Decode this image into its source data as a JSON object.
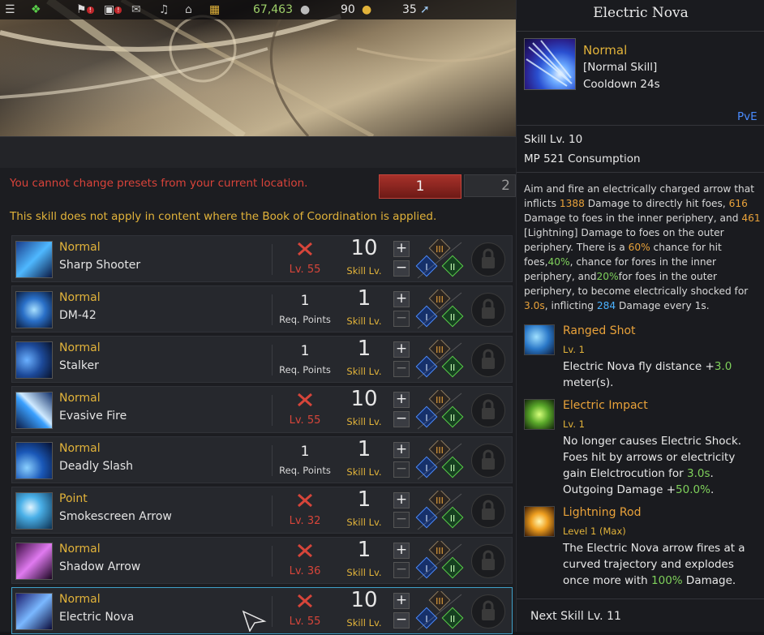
{
  "topbar": {
    "currency1": "67,463",
    "currency2": "90",
    "currency3": "35"
  },
  "warnings": {
    "preset": "You cannot change presets from your current location.",
    "book": "This skill does not apply in content where the Book of Coordination is applied."
  },
  "presets": [
    "1",
    "2"
  ],
  "skills": [
    {
      "type": "Normal",
      "name": "Sharp Shooter",
      "req_kind": "locked",
      "req": "Lv. 55",
      "skill_level": "10",
      "skill_lv_label": "Skill Lv."
    },
    {
      "type": "Normal",
      "name": "DM-42",
      "req_kind": "points",
      "req": "1",
      "req_label": "Req. Points",
      "skill_level": "1",
      "skill_lv_label": "Skill Lv."
    },
    {
      "type": "Normal",
      "name": "Stalker",
      "req_kind": "points",
      "req": "1",
      "req_label": "Req. Points",
      "skill_level": "1",
      "skill_lv_label": "Skill Lv."
    },
    {
      "type": "Normal",
      "name": "Evasive Fire",
      "req_kind": "locked",
      "req": "Lv. 55",
      "skill_level": "10",
      "skill_lv_label": "Skill Lv."
    },
    {
      "type": "Normal",
      "name": "Deadly Slash",
      "req_kind": "points",
      "req": "1",
      "req_label": "Req. Points",
      "skill_level": "1",
      "skill_lv_label": "Skill Lv."
    },
    {
      "type": "Point",
      "name": "Smokescreen Arrow",
      "req_kind": "locked",
      "req": "Lv. 32",
      "skill_level": "1",
      "skill_lv_label": "Skill Lv."
    },
    {
      "type": "Normal",
      "name": "Shadow Arrow",
      "req_kind": "locked",
      "req": "Lv. 36",
      "skill_level": "1",
      "skill_lv_label": "Skill Lv."
    },
    {
      "type": "Normal",
      "name": "Electric Nova",
      "req_kind": "locked",
      "req": "Lv. 55",
      "skill_level": "10",
      "skill_lv_label": "Skill Lv."
    }
  ],
  "tooltip": {
    "title": "Electric Nova",
    "type": "Normal",
    "category": "[Normal Skill]",
    "cooldown": "Cooldown 24s",
    "pve": "PvE",
    "skill_lv": "Skill Lv. 10",
    "mp": "MP 521 Consumption",
    "description": "Aim and fire an electrically charged arrow that inflicts 1388 Damage to directly hit foes, 616 Damage to foes in the inner periphery, and 461 [Lightning] Damage to foes on the outer periphery. There is a 60% chance for hit foes,40%, chance for fores in the inner periphery, and20%for foes in the outer periphery, to become electrically shocked for 3.0s, inflicting 284 Damage every 1s.",
    "desc_parts": {
      "p1": "Aim and fire an electrically charged arrow that inflicts ",
      "v1": "1388",
      "p2": " Damage to directly hit foes, ",
      "v2": "616",
      "p3": " Damage to foes in the inner periphery, and ",
      "v3": "461",
      "p4": " [Lightning] Damage to foes on the outer periphery. There is a ",
      "v4": "60%",
      "p5": " chance for hit foes,",
      "v5": "40%",
      "p6": ", chance for fores in the inner periphery, and",
      "v6": "20%",
      "p7": "for foes in the outer periphery, to become electrically shocked for ",
      "v7": "3.0s",
      "p8": ", inflicting ",
      "v8": "284",
      "p9": " Damage every 1s."
    },
    "tripods": [
      {
        "name": "Ranged Shot",
        "level": "Lv. 1",
        "line1": "Electric Nova fly distance +",
        "value1": "3.0",
        "line2": "meter(s)."
      },
      {
        "name": "Electric Impact",
        "level": "Lv. 1",
        "line1": "No longer causes Electric Shock.",
        "line2a": "Foes hit by arrows or electricity",
        "line2b": "gain Elelctrocution for ",
        "value1": "3.0s",
        "line2c": ".",
        "line3a": "Outgoing Damage +",
        "value2": "50.0%",
        "line3b": "."
      },
      {
        "name": "Lightning Rod",
        "level": "Level 1 (Max)",
        "line1": "The Electric Nova arrow fires at a",
        "line2": "curved trajectory and explodes",
        "line3a": "once more with ",
        "value1": "100%",
        "line3b": " Damage."
      }
    ],
    "next_level": "Next Skill Lv. 11"
  },
  "colors": {
    "gold": "#e2b33a",
    "orange": "#e9a23a",
    "green": "#7fd15b",
    "blue": "#4cb2ff",
    "red": "#d6453a"
  }
}
